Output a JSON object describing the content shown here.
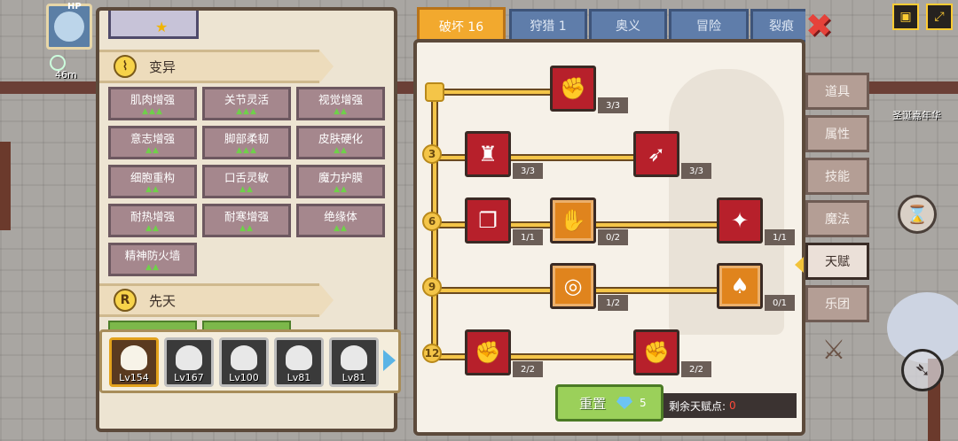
{
  "hud": {
    "hp_tag": "HP",
    "distance": "46m"
  },
  "left_panel": {
    "mutation_section": {
      "label": "变异",
      "icon": "dna-icon"
    },
    "innate_section": {
      "label": "先天",
      "icon_letter": "R"
    },
    "talents": [
      {
        "name": "肌肉增强",
        "level": "▲▲▲"
      },
      {
        "name": "关节灵活",
        "level": "▲▲▲"
      },
      {
        "name": "视觉增强",
        "level": "▲▲"
      },
      {
        "name": "意志增强",
        "level": "▲▲"
      },
      {
        "name": "脚部柔韧",
        "level": "▲▲▲"
      },
      {
        "name": "皮肤硬化",
        "level": "▲▲"
      },
      {
        "name": "细胞重构",
        "level": "▲▲"
      },
      {
        "name": "口舌灵敏",
        "level": "▲▲"
      },
      {
        "name": "魔力护膜",
        "level": "▲▲"
      },
      {
        "name": "耐热增强",
        "level": "▲▲"
      },
      {
        "name": "耐寒增强",
        "level": "▲▲"
      },
      {
        "name": "绝缘体",
        "level": "▲▲"
      },
      {
        "name": "精神防火墙",
        "level": "▲▲"
      }
    ]
  },
  "party": [
    {
      "level": "Lv154",
      "active": true
    },
    {
      "level": "Lv167",
      "active": false
    },
    {
      "level": "Lv100",
      "active": false
    },
    {
      "level": "Lv81",
      "active": false
    },
    {
      "level": "Lv81",
      "active": false
    }
  ],
  "tabs": [
    {
      "label": "破坏 16",
      "active": true
    },
    {
      "label": "狩猎 1",
      "active": false
    },
    {
      "label": "奥义",
      "active": false
    },
    {
      "label": "冒险",
      "active": false
    },
    {
      "label": "裂痕",
      "active": false
    }
  ],
  "tree": {
    "levels": [
      "3",
      "6",
      "9",
      "12"
    ],
    "nodes": [
      {
        "icon": "arm-wrestle-icon",
        "count": "3/3"
      },
      {
        "icon": "muscle-body-icon",
        "count": "3/3"
      },
      {
        "icon": "arrow-strike-icon",
        "count": "3/3"
      },
      {
        "icon": "card-swap-icon",
        "count": "1/1"
      },
      {
        "icon": "punch-hand-icon",
        "count": "0/2"
      },
      {
        "icon": "impact-blast-icon",
        "count": "1/1"
      },
      {
        "icon": "shockwave-icon",
        "count": "1/2"
      },
      {
        "icon": "demon-wings-icon",
        "count": "0/1"
      },
      {
        "icon": "fist-icon",
        "count": "2/2"
      },
      {
        "icon": "striking-fist-icon",
        "count": "2/2"
      }
    ]
  },
  "reset": {
    "label": "重置",
    "cost": "5"
  },
  "points": {
    "label": "剩余天赋点:",
    "value": "0"
  },
  "side_menu": [
    {
      "label": "道具",
      "active": false
    },
    {
      "label": "属性",
      "active": false
    },
    {
      "label": "技能",
      "active": false
    },
    {
      "label": "魔法",
      "active": false
    },
    {
      "label": "天赋",
      "active": true
    },
    {
      "label": "乐团",
      "active": false
    }
  ],
  "world": {
    "location_label": "圣诞嘉年华"
  },
  "colors": {
    "active_tab": "#f2a92e",
    "inactive_tab": "#5f7daa",
    "red_node": "#b7202b",
    "orange_node": "#e0841d",
    "path_gold": "#f4c548"
  }
}
